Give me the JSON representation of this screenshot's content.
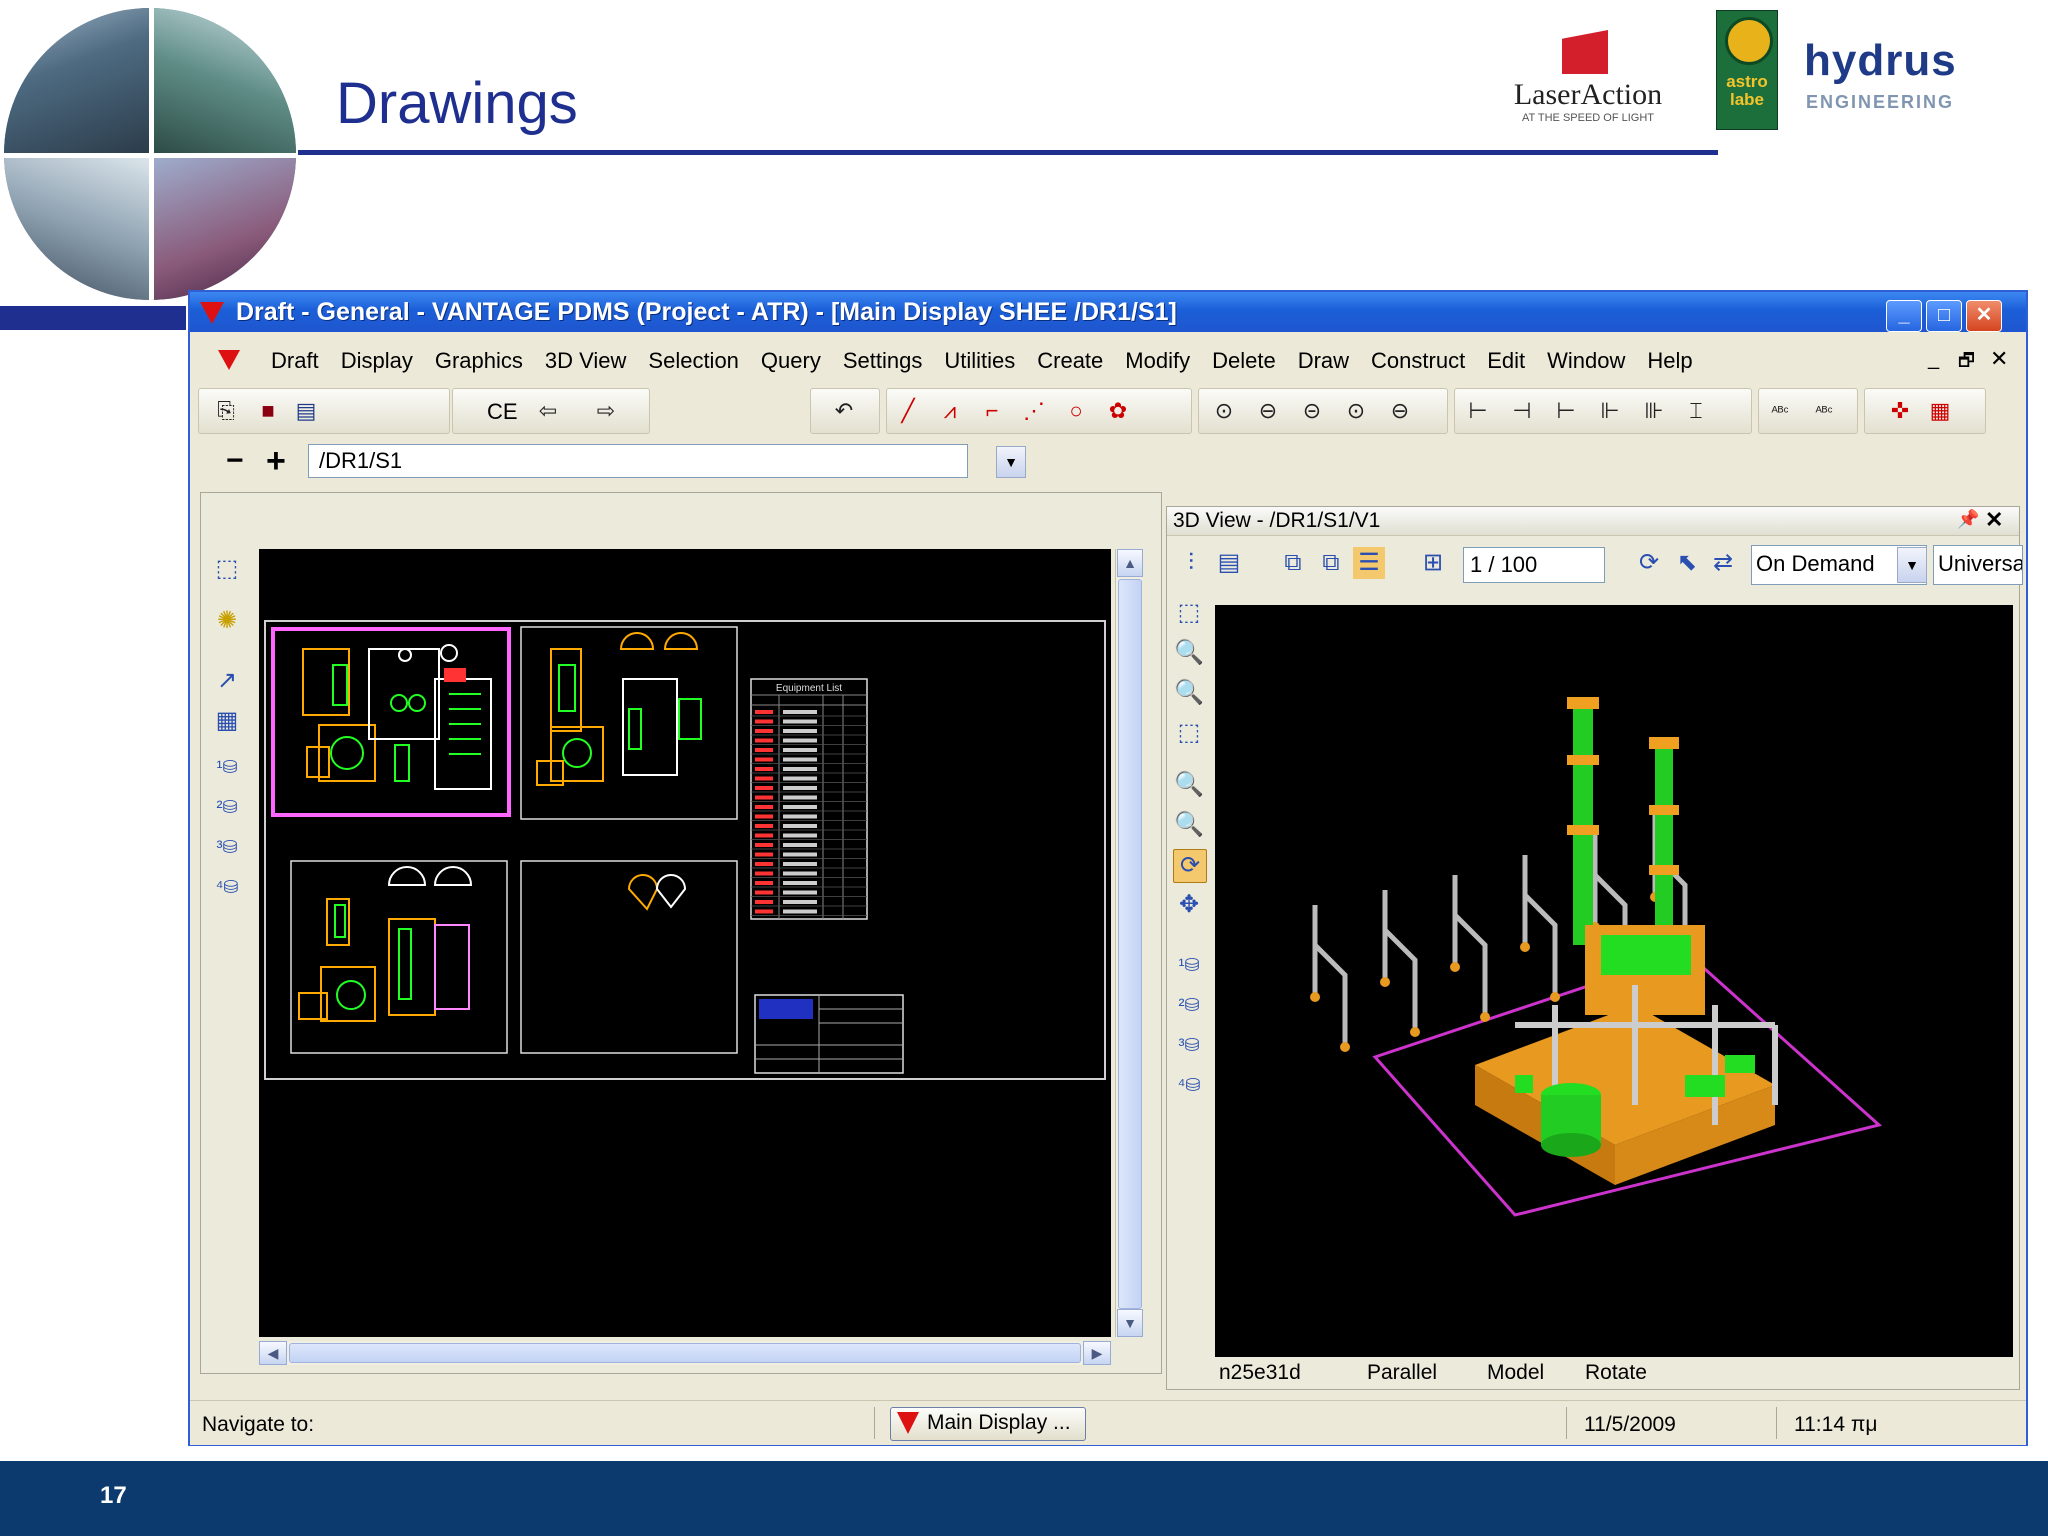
{
  "slide": {
    "title": "Drawings",
    "number": "17"
  },
  "logos": {
    "laseraction_name": "LaserAction",
    "laseraction_tagline": "AT THE SPEED OF LIGHT",
    "astro_name": "astro labe",
    "hydrus_name": "hydrus",
    "hydrus_sub": "ENGINEERING"
  },
  "window": {
    "title": "Draft - General - VANTAGE PDMS (Project - ATR) - [Main Display   SHEE  /DR1/S1]",
    "min": "_",
    "max": "□",
    "close": "✕"
  },
  "menu": {
    "items": [
      "Draft",
      "Display",
      "Graphics",
      "3D View",
      "Selection",
      "Query",
      "Settings",
      "Utilities",
      "Create",
      "Modify",
      "Delete",
      "Draw",
      "Construct",
      "Edit",
      "Window",
      "Help"
    ],
    "mdi_min": "_",
    "mdi_restore": "🗗",
    "mdi_close": "✕"
  },
  "toolbar": {
    "ce_label": "CE"
  },
  "path_bar": {
    "zoom_out": "−",
    "zoom_in": "+",
    "current_path": "/DR1/S1"
  },
  "drawing": {
    "equipment_list_title": "Equipment List"
  },
  "view3d": {
    "title": "3D View - /DR1/S1/V1",
    "scale": "1 / 100",
    "update_mode": "On Demand",
    "universal": "Universa",
    "status": {
      "element": "n25e31d",
      "projection": "Parallel",
      "mode": "Model",
      "action": "Rotate"
    }
  },
  "statusbar": {
    "navigate": "Navigate to:",
    "main_display": "Main Display ...",
    "date": "11/5/2009",
    "time": "11:14 πμ"
  },
  "colors": {
    "accent_blue": "#1f2f8f",
    "footer": "#0c3a6e",
    "titlebar": "#1b5fd8"
  }
}
